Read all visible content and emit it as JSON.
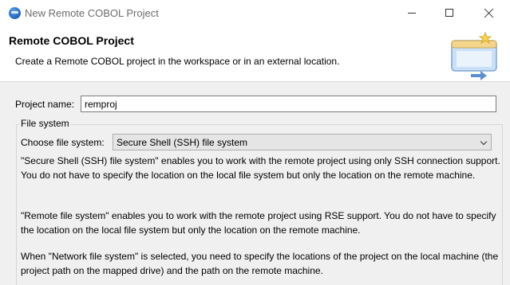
{
  "window": {
    "title": "New Remote COBOL Project",
    "icon": "eclipse-app-icon"
  },
  "banner": {
    "title": "Remote COBOL Project",
    "description": "Create a Remote COBOL project in the workspace or in an external location.",
    "graphic": "new-project-wizard-icon"
  },
  "form": {
    "project_name_label": "Project name:",
    "project_name_value": "remproj",
    "group_title": "File system",
    "choose_label": "Choose file system:",
    "file_system_selected": "Secure Shell (SSH) file system",
    "descriptions": [
      "\"Secure Shell (SSH) file system\" enables you to work with the remote project using only SSH connection support. You do not have to specify the location on the local file system but only the location on the remote machine.",
      "\"Remote file system\" enables you to work with the remote project using RSE support. You do not have to specify the location on the local file system but only the location on the remote machine.",
      "When \"Network file system\" is selected, you need to specify the locations of the project on the local machine (the project path on the mapped drive) and the path on the remote machine."
    ]
  },
  "colors": {
    "titlebar_bg": "#ffffff",
    "dialog_bg": "#f0f0f0",
    "select_bg": "#e5e5e5"
  }
}
